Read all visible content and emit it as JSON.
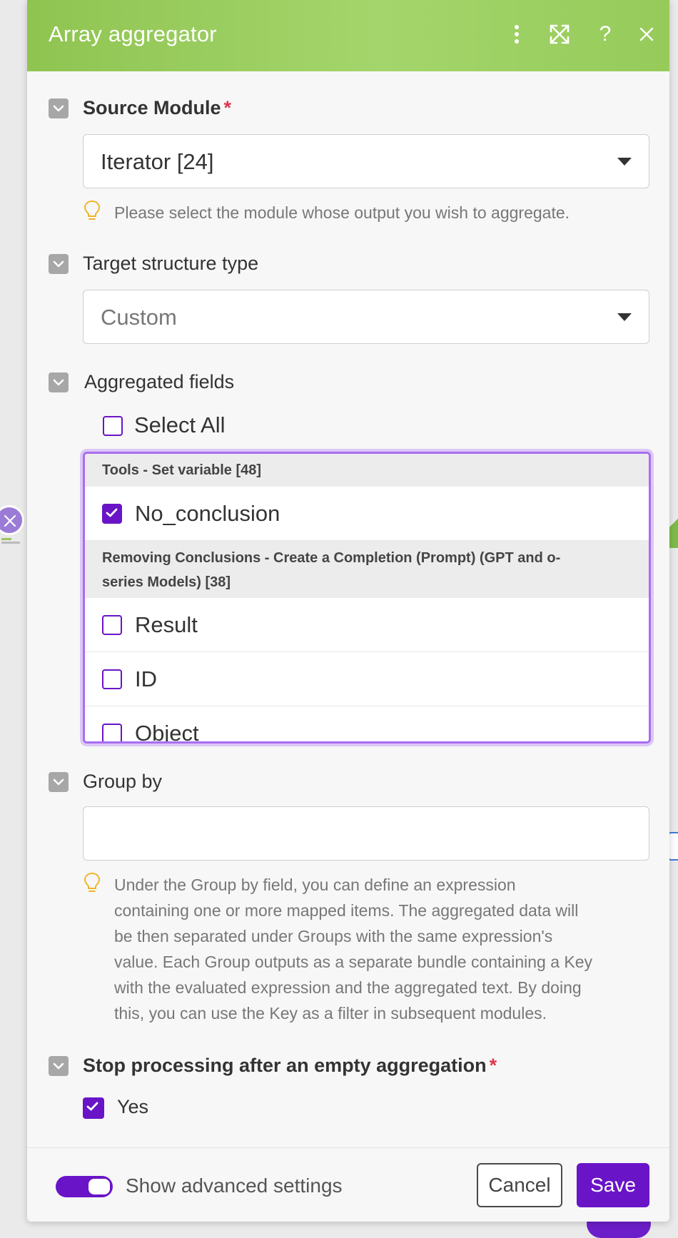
{
  "dialog": {
    "title": "Array aggregator"
  },
  "header_icons": [
    "more-vertical-icon",
    "expand-icon",
    "help-icon",
    "close-icon"
  ],
  "source_module": {
    "label": "Source Module",
    "required_mark": "*",
    "value": "Iterator [24]",
    "hint": "Please select the module whose output you wish to aggregate."
  },
  "target_structure": {
    "label": "Target structure type",
    "value": "Custom"
  },
  "aggregated_fields": {
    "label": "Aggregated fields",
    "select_all": {
      "label": "Select All",
      "checked": false
    },
    "groups": [
      {
        "title": "Tools - Set variable [48]",
        "items": [
          {
            "label": "No_conclusion",
            "checked": true
          }
        ]
      },
      {
        "title": "Removing Conclusions - Create a Completion (Prompt) (GPT and o-series Models) [38]",
        "title_line1": "Removing Conclusions - Create a Completion (Prompt) (GPT and o-",
        "title_line2": "series Models) [38]",
        "items": [
          {
            "label": "Result",
            "checked": false
          },
          {
            "label": "ID",
            "checked": false
          },
          {
            "label": "Object",
            "checked": false
          }
        ]
      }
    ]
  },
  "group_by": {
    "label": "Group by",
    "value": "",
    "hint_lines": [
      "Under the Group by field, you can define an expression",
      "containing one or more mapped items. The aggregated data will",
      "be then separated under Groups with the same expression's",
      "value. Each Group outputs as a separate bundle containing a Key",
      "with the evaluated expression and the aggregated text. By doing",
      "this, you can use the Key as a filter in subsequent modules."
    ]
  },
  "stop_processing": {
    "label": "Stop processing after an empty aggregation",
    "required_mark": "*",
    "option_label": "Yes",
    "checked": true
  },
  "footer": {
    "advanced_label": "Show advanced settings",
    "advanced_enabled": true,
    "cancel_label": "Cancel",
    "save_label": "Save"
  },
  "colors": {
    "header_green": "#96cb5a",
    "accent_purple": "#6a14c7",
    "required_red": "#e0364e"
  }
}
